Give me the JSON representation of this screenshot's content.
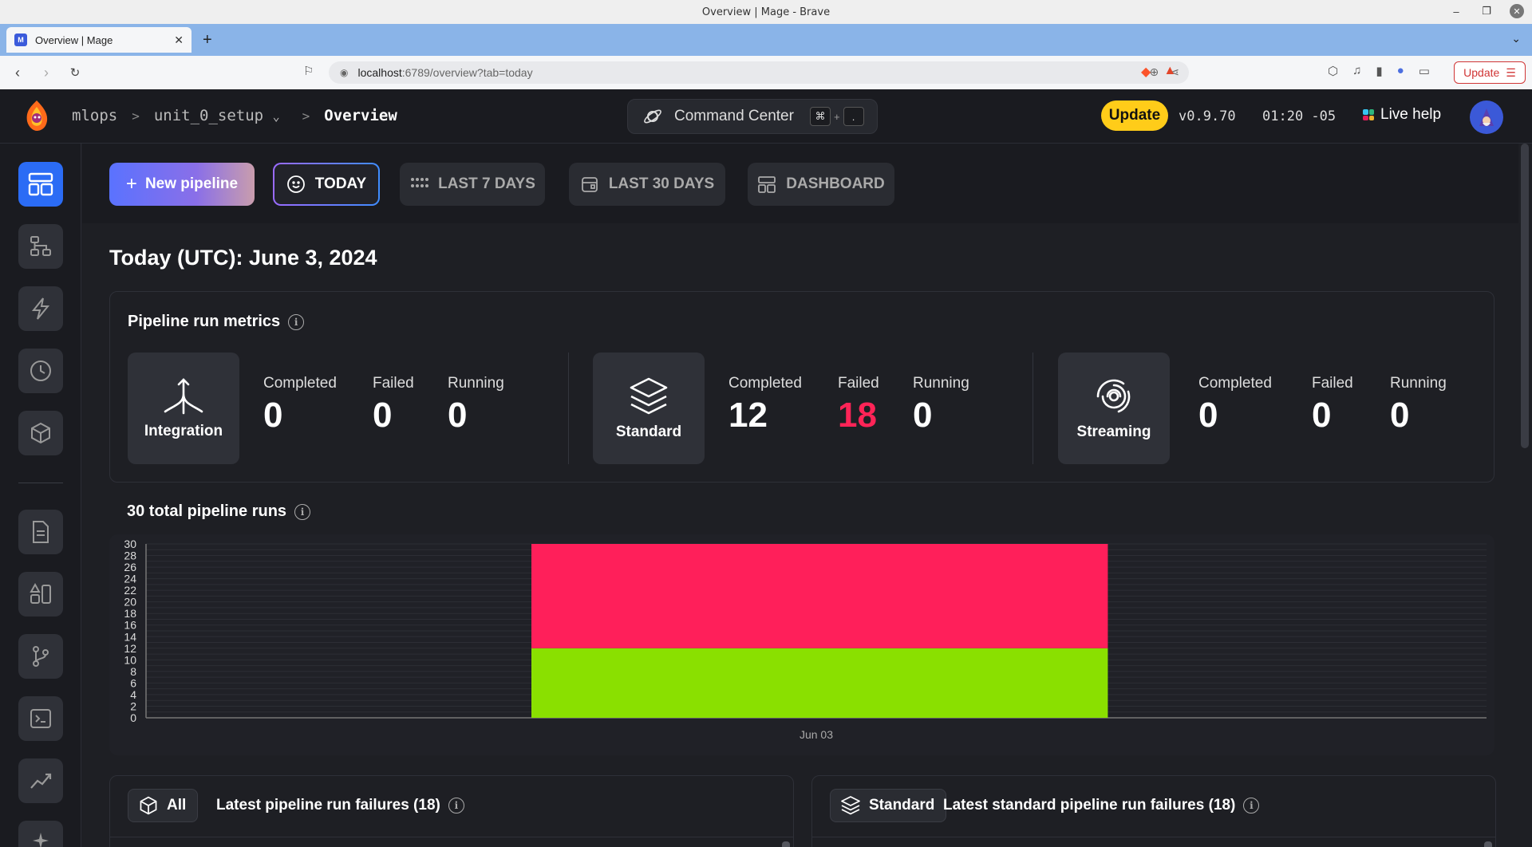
{
  "os": {
    "window_title": "Overview | Mage - Brave"
  },
  "browser": {
    "tab_title": "Overview | Mage",
    "url_host": "localhost",
    "url_path": ":6789/overview?tab=today",
    "update_label": "Update"
  },
  "header": {
    "breadcrumbs": [
      "mlops",
      "unit_0_setup",
      "Overview"
    ],
    "command_center": "Command Center",
    "shortcut_keys": [
      "⌘",
      "."
    ],
    "shortcut_plus": "+",
    "update_label": "Update",
    "version": "v0.9.70",
    "time": "01:20 -05",
    "live_help": "Live help"
  },
  "toolbar": {
    "new_pipeline": "New pipeline",
    "tabs": [
      "TODAY",
      "LAST 7 DAYS",
      "LAST 30 DAYS",
      "DASHBOARD"
    ],
    "active_tab": "TODAY"
  },
  "page_title": "Today (UTC): June 3, 2024",
  "metrics": {
    "heading": "Pipeline run metrics",
    "groups": [
      {
        "type": "Integration",
        "completed": "0",
        "failed": "0",
        "running": "0"
      },
      {
        "type": "Standard",
        "completed": "12",
        "failed": "18",
        "running": "0"
      },
      {
        "type": "Streaming",
        "completed": "0",
        "failed": "0",
        "running": "0"
      }
    ],
    "labels": {
      "completed": "Completed",
      "failed": "Failed",
      "running": "Running"
    }
  },
  "chart_heading": "30 total pipeline runs",
  "chart_data": {
    "type": "bar",
    "stacked": true,
    "categories": [
      "Jun 03"
    ],
    "series": [
      {
        "values": [
          12
        ],
        "color": "#8ae000"
      },
      {
        "values": [
          18
        ],
        "color": "#ff1f5a"
      }
    ],
    "ylim": [
      0,
      30
    ],
    "yticks": [
      0,
      2,
      4,
      6,
      8,
      10,
      12,
      14,
      16,
      18,
      20,
      22,
      24,
      26,
      28,
      30
    ],
    "grid": true
  },
  "failures": [
    {
      "pill": "All",
      "title": "Latest pipeline run failures (18)"
    },
    {
      "pill": "Standard",
      "title": "Latest standard pipeline run failures (18)"
    }
  ]
}
